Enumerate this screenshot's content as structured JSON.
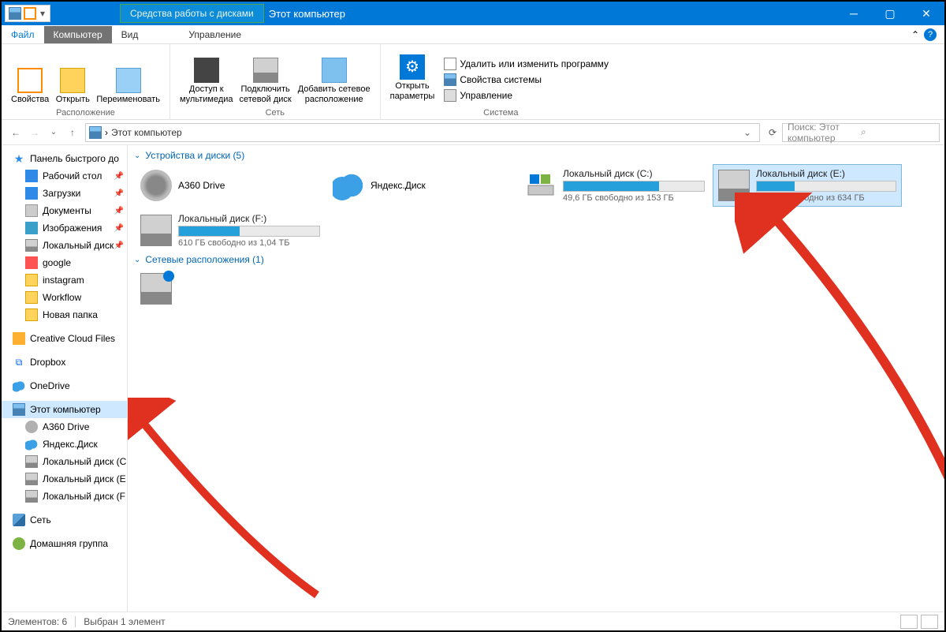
{
  "title_tab": "Средства работы с дисками",
  "title_text": "Этот компьютер",
  "ribbon_tabs": {
    "file": "Файл",
    "computer": "Компьютер",
    "view": "Вид",
    "manage": "Управление"
  },
  "ribbon": {
    "props": "Свойства",
    "open": "Открыть",
    "rename": "Переименовать",
    "grp_location": "Расположение",
    "media": "Доступ к\nмультимедиа",
    "netdrive": "Подключить\nсетевой диск",
    "addnet": "Добавить сетевое\nрасположение",
    "grp_network": "Сеть",
    "settings": "Открыть\nпараметры",
    "uninstall": "Удалить или изменить программу",
    "sysprops": "Свойства системы",
    "manage": "Управление",
    "grp_system": "Система"
  },
  "address": "Этот компьютер",
  "search_placeholder": "Поиск: Этот компьютер",
  "sidebar": {
    "quick": "Панель быстрого до",
    "desktop": "Рабочий стол",
    "downloads": "Загрузки",
    "documents": "Документы",
    "pictures": "Изображения",
    "localdisk": "Локальный диск",
    "google": "google",
    "instagram": "instagram",
    "workflow": "Workflow",
    "newfolder": "Новая папка",
    "ccfiles": "Creative Cloud Files",
    "dropbox": "Dropbox",
    "onedrive": "OneDrive",
    "thispc": "Этот компьютер",
    "a360": "A360 Drive",
    "yadisk": "Яндекс.Диск",
    "ldc": "Локальный диск (С",
    "lde": "Локальный диск (E",
    "ldf": "Локальный диск (F",
    "network": "Сеть",
    "homegroup": "Домашняя группа"
  },
  "groups": {
    "devices": "Устройства и диски (5)",
    "netloc": "Сетевые расположения (1)"
  },
  "drives": {
    "a360": "A360 Drive",
    "yandex": "Яндекс.Диск",
    "c": {
      "name": "Локальный диск (C:)",
      "status": "49,6 ГБ свободно из 153 ГБ",
      "fill": 68
    },
    "e": {
      "name": "Локальный диск (E:)",
      "status": "465 ГБ свободно из 634 ГБ",
      "fill": 27
    },
    "f": {
      "name": "Локальный диск (F:)",
      "status": "610 ГБ свободно из 1,04 ТБ",
      "fill": 43
    }
  },
  "status": {
    "count": "Элементов: 6",
    "selected": "Выбран 1 элемент"
  }
}
